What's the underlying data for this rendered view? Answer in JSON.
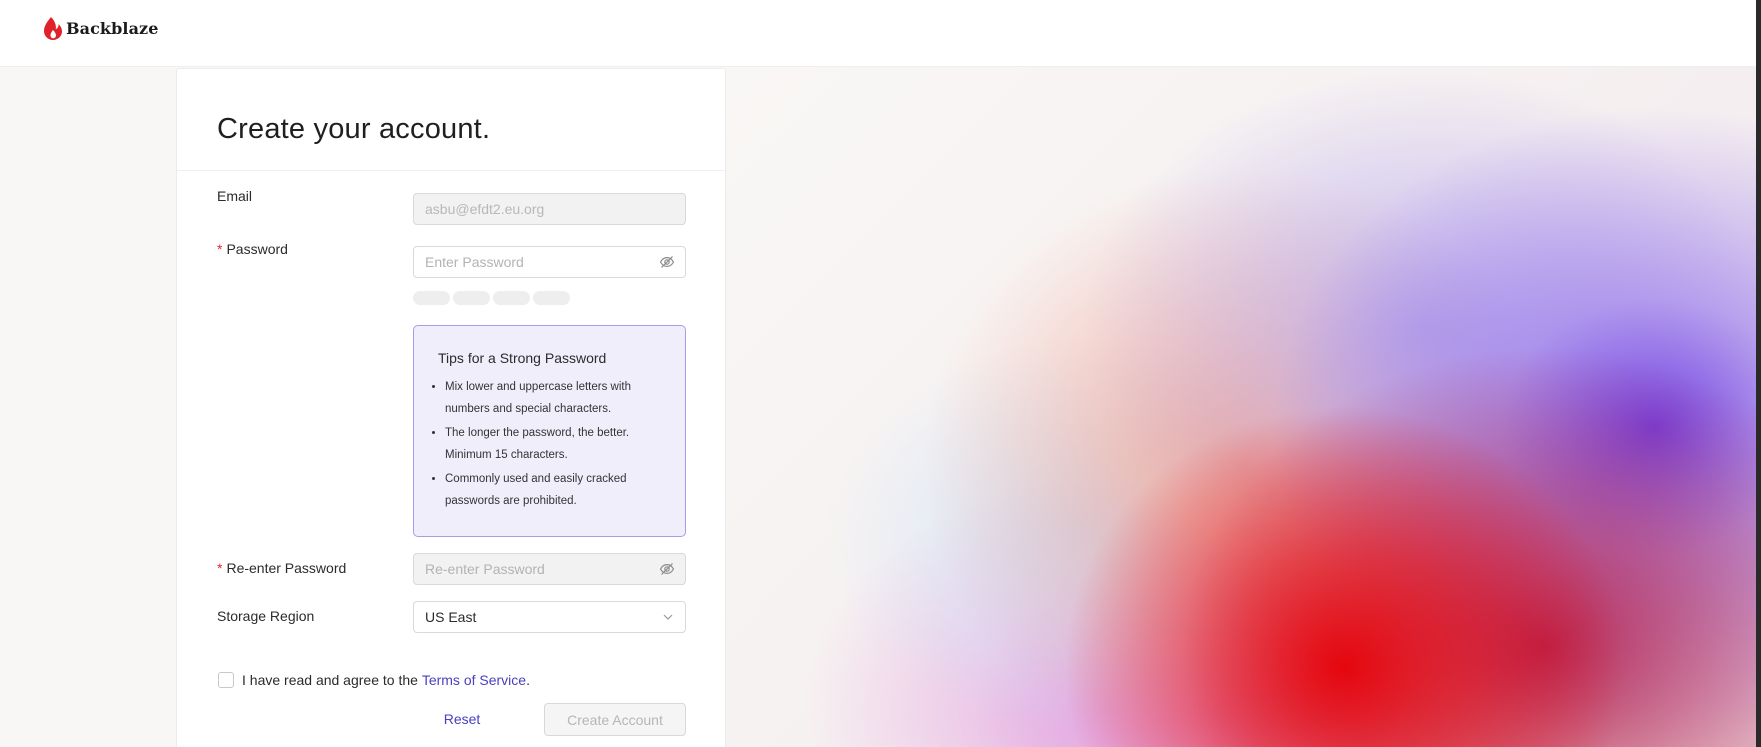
{
  "header": {
    "brand": "Backblaze",
    "logo_icon": "flame-icon",
    "brand_color": "#e0202a"
  },
  "form": {
    "title": "Create your account.",
    "email": {
      "label": "Email",
      "value": "asbu@efdt2.eu.org"
    },
    "password": {
      "required_mark": "*",
      "label": "Password",
      "placeholder": "Enter Password",
      "toggle_icon": "eye-slash-icon"
    },
    "strength_meter_segments": 4,
    "tips": {
      "title": "Tips for a Strong Password",
      "items": [
        "Mix lower and uppercase letters with numbers and special characters.",
        "The longer the password, the better. Minimum 15 characters.",
        "Commonly used and easily cracked passwords are prohibited."
      ]
    },
    "reenter_password": {
      "required_mark": "*",
      "label": "Re-enter Password",
      "placeholder": "Re-enter Password",
      "toggle_icon": "eye-slash-icon"
    },
    "storage_region": {
      "label": "Storage Region",
      "value": "US East",
      "icon": "chevron-down-icon"
    },
    "agree": {
      "text": "I have read and agree to the ",
      "link_text": "Terms of Service",
      "suffix": ".",
      "checked": false
    },
    "reset_label": "Reset",
    "create_label": "Create Account"
  },
  "colors": {
    "accent_link": "#4a3fc0",
    "required": "#e0282e",
    "tips_bg": "#f1eefc",
    "tips_border": "#a89ce9"
  }
}
